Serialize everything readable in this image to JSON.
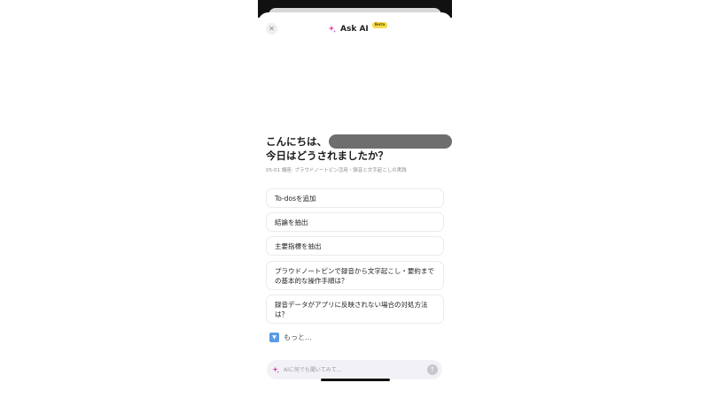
{
  "header": {
    "close_icon": "close-icon",
    "sparkle_icon": "sparkle-icon",
    "title": "Ask AI",
    "badge": "Beta"
  },
  "greeting": {
    "line1": "こんにちは、",
    "line2": "今日はどうされましたか？",
    "context": "05-01 講座: プラウドノートピン活用・録音と文字起こしの実践"
  },
  "suggestions": [
    {
      "label": "To-dosを追加"
    },
    {
      "label": "結論を抽出"
    },
    {
      "label": "主要指標を抽出"
    },
    {
      "label": "プラウドノートピンで録音から文字起こし・要約までの基本的な操作手順は？"
    },
    {
      "label": "録音データがアプリに反映されない場合の対処方法は？"
    }
  ],
  "more": {
    "icon": "chevron-down-icon",
    "label": "もっと..."
  },
  "input": {
    "placeholder": "AIに何でも聞いてみて...",
    "value": "",
    "send_icon": "arrow-up-icon"
  },
  "colors": {
    "accent": "#e0479e",
    "badge_bg": "#f7d94c",
    "more_icon_bg": "#5a9be6"
  }
}
